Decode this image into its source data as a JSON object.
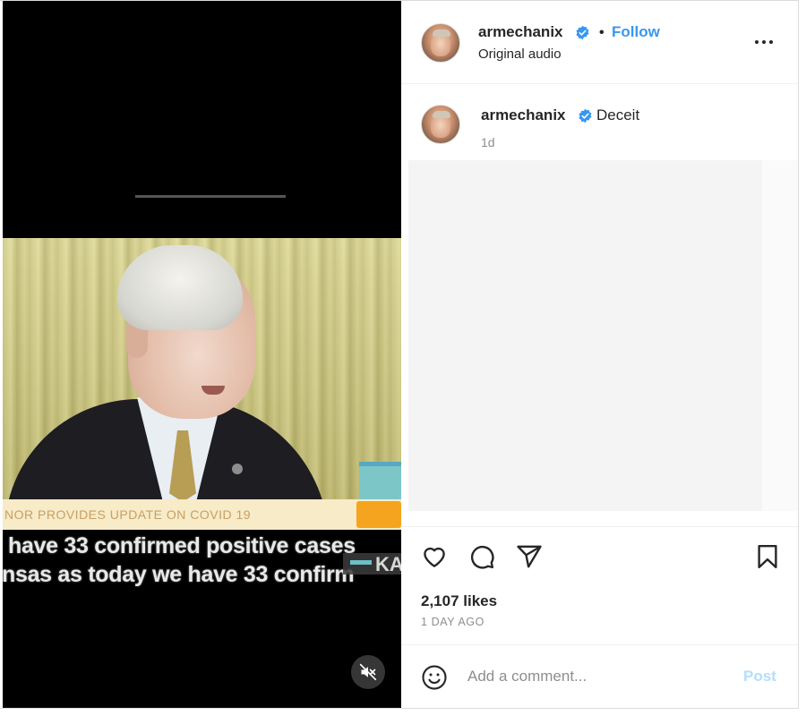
{
  "header": {
    "username": "armechanix",
    "separator": "•",
    "follow_label": "Follow",
    "audio_label": "Original audio",
    "more_icon": "more-horizontal-icon"
  },
  "caption": {
    "username": "armechanix",
    "text": "Deceit",
    "time": "1d"
  },
  "video": {
    "ticker_text": "NOR PROVIDES UPDATE ON COVID 19",
    "subtitle_line1": "have 33 confirmed positive cases",
    "subtitle_line2": "nsas as today we have 33 confirm",
    "channel_badge": "KA",
    "muted": true
  },
  "actions": {
    "like_icon": "heart-icon",
    "comment_icon": "speech-bubble-icon",
    "share_icon": "paper-plane-icon",
    "save_icon": "bookmark-icon"
  },
  "stats": {
    "likes": "2,107 likes",
    "date": "1 DAY AGO"
  },
  "comment_box": {
    "placeholder": "Add a comment...",
    "post_label": "Post"
  },
  "colors": {
    "accent": "#3897f0",
    "verified": "#3897f0",
    "post_disabled": "#b2dffc",
    "muted_text": "#8e8e8e"
  }
}
